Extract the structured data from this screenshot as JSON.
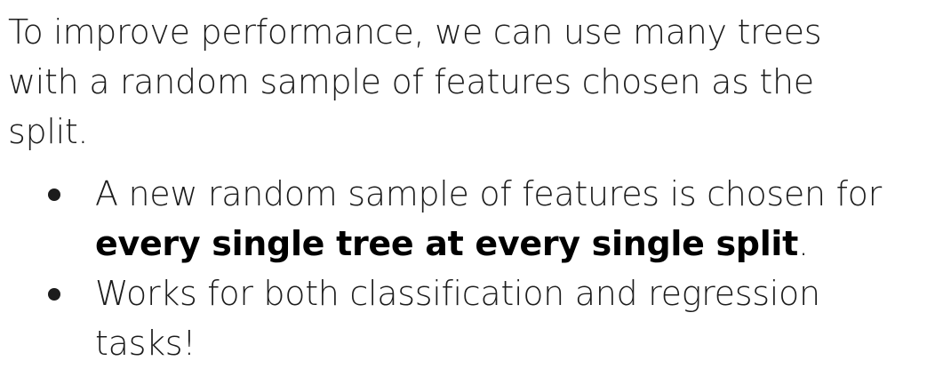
{
  "intro": {
    "text": "To improve performance, we can use many trees with a random sample of features chosen as the split."
  },
  "bullets": [
    {
      "text_before": "A new random sample of features is chosen for ",
      "bold": "every single tree at every single split",
      "text_after": "."
    },
    {
      "text_before": "Works for both classification and regression tasks!",
      "bold": "",
      "text_after": ""
    }
  ]
}
